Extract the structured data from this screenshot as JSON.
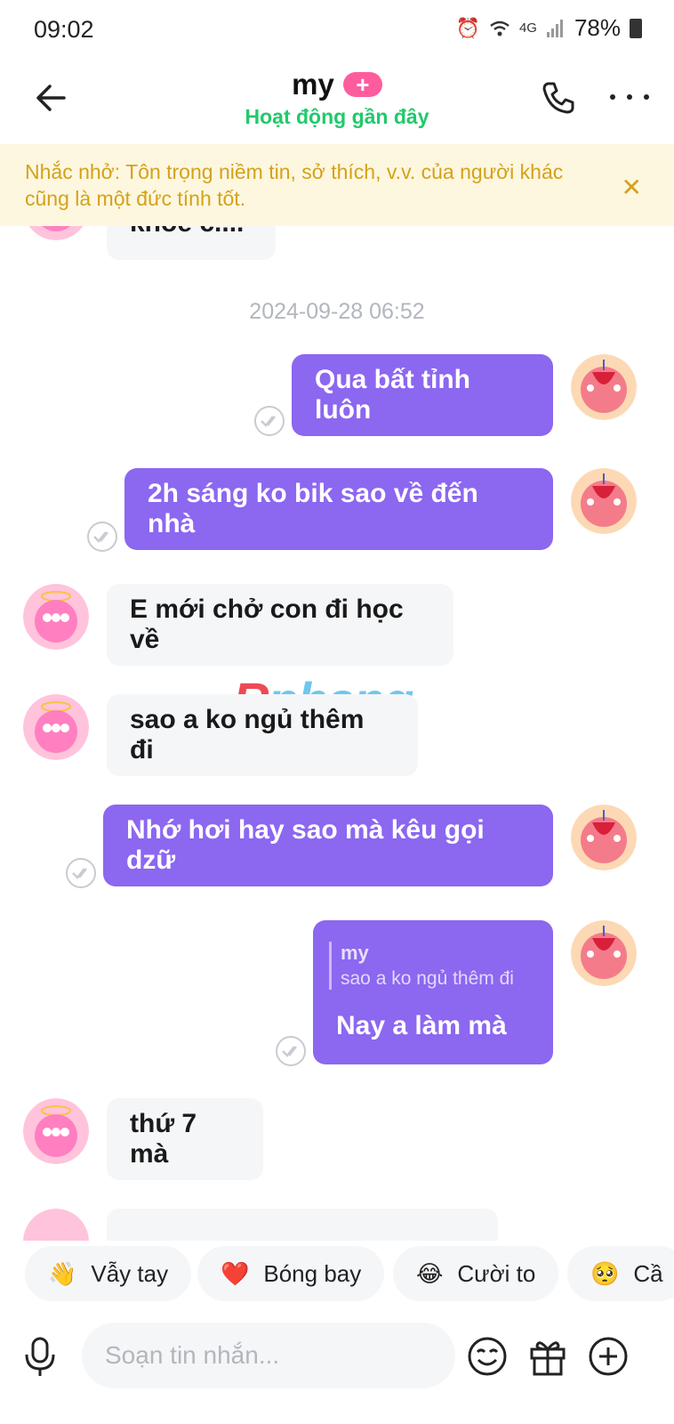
{
  "status_bar": {
    "time": "09:02",
    "network": "4G",
    "battery": "78%"
  },
  "header": {
    "contact_name": "my",
    "plus_badge": "+",
    "activity_status": "Hoạt động gần đây"
  },
  "reminder": {
    "text": "Nhắc nhở: Tôn trọng niềm tin, sở thích, v.v. của người khác cũng là một đức tính tốt."
  },
  "chat": {
    "partial_top_message": "khoẻ c....",
    "timestamp": "2024-09-28 06:52",
    "messages": [
      {
        "direction": "out",
        "text": "Qua bất tỉnh luôn"
      },
      {
        "direction": "out",
        "text": "2h sáng ko bik sao về đến nhà"
      },
      {
        "direction": "in",
        "text": "E mới chở con đi học về"
      },
      {
        "direction": "in",
        "text": "sao a ko ngủ thêm đi"
      },
      {
        "direction": "out",
        "text": "Nhớ hơi hay sao mà kêu gọi dzữ"
      },
      {
        "direction": "out",
        "text": "Nay a làm mà",
        "reply_to": {
          "name": "my",
          "text": "sao a ko ngủ thêm đi"
        }
      },
      {
        "direction": "in",
        "text": "thứ 7 mà"
      }
    ],
    "watermark": {
      "first": "R",
      "rest": "phang"
    }
  },
  "quick_reactions": [
    {
      "emoji": "👋",
      "label": "Vẫy tay"
    },
    {
      "emoji": "❤️",
      "label": "Bóng bay"
    },
    {
      "emoji": "😂",
      "label": "Cười to"
    },
    {
      "emoji": "🥺",
      "label": "Cầ"
    }
  ],
  "input": {
    "placeholder": "Soạn tin nhắn..."
  },
  "colors": {
    "outgoing_bubble": "#8c67f0",
    "incoming_bubble": "#f5f6f8",
    "activity_green": "#21c96b",
    "reminder_bg": "#fdf7e0",
    "reminder_text": "#d4a21a",
    "plus_badge": "#ff5c9e"
  }
}
